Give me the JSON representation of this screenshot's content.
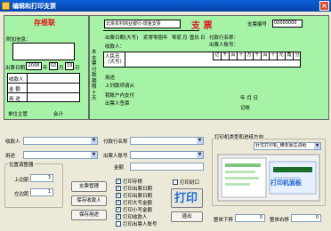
{
  "window": {
    "title": "编辑和打印支票",
    "close_label": "×"
  },
  "stub": {
    "heading": "存根联",
    "extra_info_label": "附加信息：",
    "date_label": "出票日期",
    "year": "2008",
    "year_unit": "年",
    "month": "02",
    "month_unit": "月",
    "day": "19",
    "day_unit": "日",
    "rows": [
      "收款人",
      "金  额",
      "用  途"
    ],
    "manager_label": "单位主管",
    "accountant_label": "会计"
  },
  "cheque": {
    "bank_name": "北京农村商业银行-现金支票",
    "title": "支  票",
    "number_label": "支票编号",
    "number_value": "00000000",
    "date_caption": "出票日期(大写)",
    "date_year": "贰零零捌年",
    "date_month": "零贰",
    "date_month_unit": "月",
    "date_day": "壹玖",
    "date_day_unit": "日",
    "bank_label": "付款行名称：",
    "payee_label": "收款人：",
    "drawer_account_label": "出票人账号：",
    "period_caption": "本支票付款期限十天",
    "amount_caption": "人民币（大写）",
    "digit_headers": [
      "亿",
      "千",
      "百",
      "十",
      "万",
      "千",
      "百",
      "十",
      "元",
      "角",
      "分"
    ],
    "purpose_label": "用途",
    "above_label": "上列款项请从",
    "account_label": "我账户内支付",
    "signature_label": "出票人签章",
    "ymd_label": "年    月    日",
    "booking_label": "记帐"
  },
  "form": {
    "payee_label": "收款人",
    "purpose_label": "用途",
    "bank_label": "付款行名称",
    "drawer_account_label": "出票人账号",
    "amount_label": "金额",
    "position_group": "位置调整器",
    "top_label": "上边距",
    "top_value": "3",
    "left_label": "左边距",
    "left_value": "1",
    "btn_manage": "支票管理",
    "btn_save_payee": "保存收款人",
    "btn_save_purpose": "保存用途",
    "print_options": [
      {
        "label": "打印存根",
        "checked": true
      },
      {
        "label": "打印出票日期",
        "checked": true
      },
      {
        "label": "打印出票日期",
        "checked": true
      },
      {
        "label": "打印大写金额",
        "checked": true
      },
      {
        "label": "打印小写金额",
        "checked": true
      },
      {
        "label": "打印收款人",
        "checked": true
      },
      {
        "label": "打印出票人账号",
        "checked": false
      }
    ],
    "print_seal": "打印封口",
    "print_button": "打印",
    "exit_button": "退出",
    "printer_group": "打印机类型和进纸方向",
    "printer_value": "针式打印机_横向靠左进纸",
    "printer_panel_caption": "打印机面板",
    "overall_down_label": "整体下移",
    "overall_down_value": "0",
    "overall_right_label": "整体右移",
    "overall_right_value": "0"
  }
}
